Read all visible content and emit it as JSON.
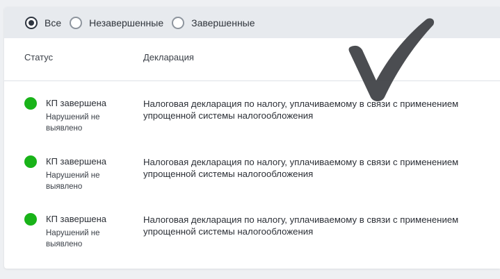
{
  "filters": [
    {
      "label": "Все",
      "checked": true
    },
    {
      "label": "Незавершенные",
      "checked": false
    },
    {
      "label": "Завершенные",
      "checked": false
    }
  ],
  "table": {
    "headers": {
      "status": "Статус",
      "declaration": "Декларация"
    },
    "rows": [
      {
        "status": "КП завершена",
        "status_detail": "Нарушений не выявлено",
        "status_color": "#19b319",
        "declaration": "Налоговая декларация по налогу, уплачиваемому в связи с применением упрощенной системы налогообложения"
      },
      {
        "status": "КП завершена",
        "status_detail": "Нарушений не выявлено",
        "status_color": "#19b319",
        "declaration": "Налоговая декларация по налогу, уплачиваемому в связи с применением упрощенной системы налогообложения"
      },
      {
        "status": "КП завершена",
        "status_detail": "Нарушений не выявлено",
        "status_color": "#19b319",
        "declaration": "Налоговая декларация по налогу, уплачиваемому в связи с применением упрощенной системы налогообложения"
      }
    ]
  },
  "overlay": {
    "icon": "checkmark-icon"
  }
}
